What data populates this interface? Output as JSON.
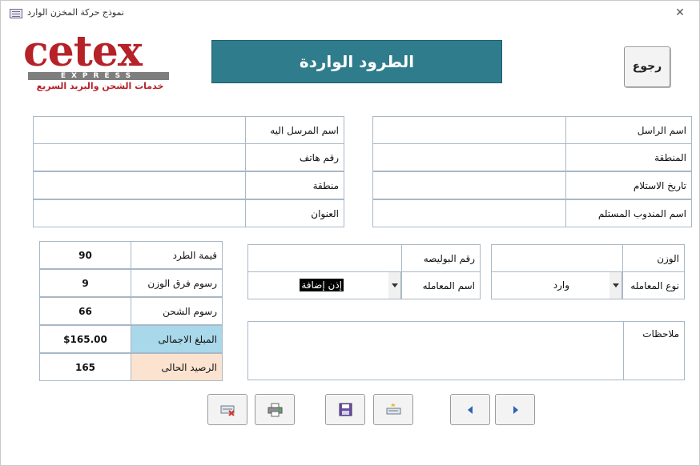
{
  "window": {
    "title": "نموذج حركة المخزن الوارد",
    "close_glyph": "✕"
  },
  "logo": {
    "word": "cetex",
    "express": "EXPRESS",
    "subtitle": "خدمات الشحن والبريد السريع"
  },
  "header": {
    "title": "الطرود الواردة",
    "back_label": "رجوع"
  },
  "sender": {
    "sender_name_label": "اسم الراسل",
    "region_label": "المنطقة",
    "receipt_date_label": "تاريخ الاستلام",
    "receiving_rep_label": "اسم المندوب المستلم"
  },
  "recipient": {
    "recipient_name_label": "اسم المرسل اليه",
    "phone_label": "رقم هاتف",
    "region_label": "منطقة",
    "address_label": "العنوان"
  },
  "transaction": {
    "weight_label": "الوزن",
    "type_label": "نوع المعامله",
    "type_value": "وارد",
    "policy_no_label": "رقم البوليصه",
    "name_label": "اسم المعامله",
    "name_value": "إذن إضافة",
    "notes_label": "ملاحظات"
  },
  "totals": {
    "parcel_value_label": "قيمة الطرد",
    "parcel_value": "90",
    "weight_diff_label": "رسوم فرق الوزن",
    "weight_diff": "9",
    "shipping_fee_label": "رسوم الشحن",
    "shipping_fee": "66",
    "total_label": "المبلغ الاجمالى",
    "total": "$165.00",
    "balance_label": "الرصيد الحالى",
    "balance": "165"
  },
  "colors": {
    "banner": "#2f7c8c",
    "total_label_bg": "#a9d8ea",
    "balance_label_bg": "#fbe3d0",
    "brand_red": "#b52228"
  },
  "toolbar": {
    "icons": [
      "delete-record-icon",
      "print-icon",
      "save-icon",
      "new-record-icon",
      "previous-icon",
      "next-icon"
    ]
  }
}
